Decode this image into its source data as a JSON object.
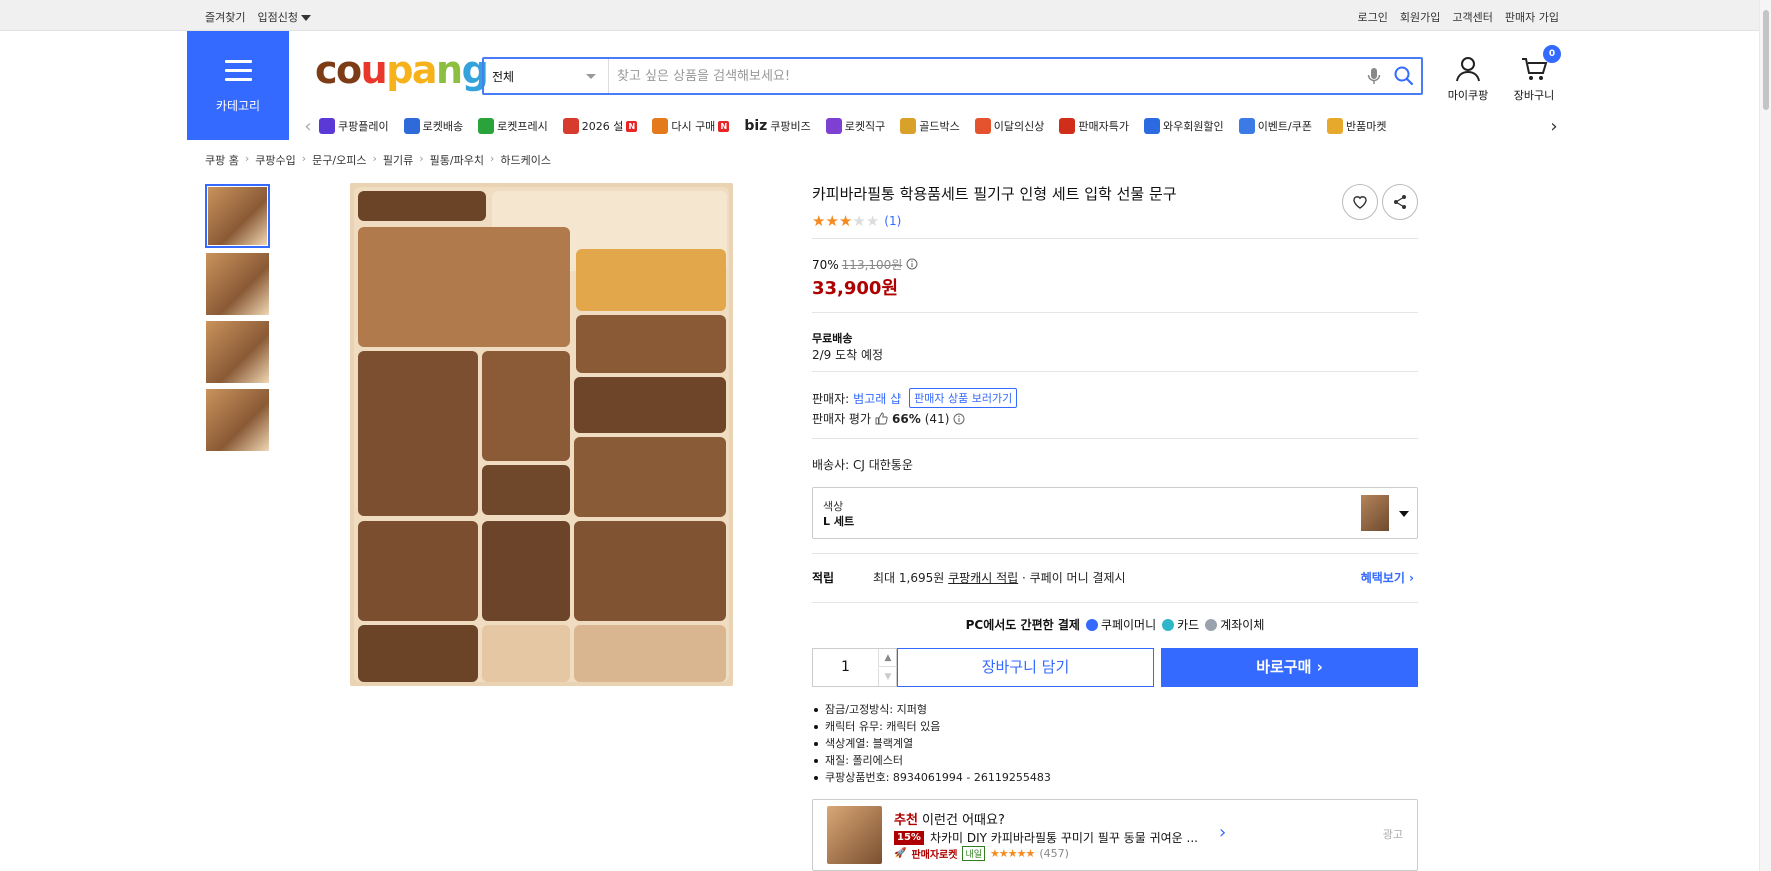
{
  "topbar": {
    "left": [
      {
        "label": "즐겨찾기"
      },
      {
        "label": "입점신청"
      }
    ],
    "right": [
      {
        "label": "로그인"
      },
      {
        "label": "회원가입"
      },
      {
        "label": "고객센터"
      },
      {
        "label": "판매자 가입"
      }
    ]
  },
  "header": {
    "category_label": "카테고리",
    "logo": {
      "c1": "co",
      "c2": "u",
      "c3": "pa",
      "c4": "n",
      "c5": "g"
    },
    "search": {
      "scope": "전체",
      "placeholder": "찾고 싶은 상품을 검색해보세요!"
    },
    "mycoupang_label": "마이쿠팡",
    "cart_label": "장바구니",
    "cart_count": "0"
  },
  "nav": {
    "items": [
      {
        "label": "쿠팡플레이",
        "icon": "play-icon",
        "color": "#5b39d6"
      },
      {
        "label": "로켓배송",
        "icon": "rocket-icon",
        "color": "#2f6ad9"
      },
      {
        "label": "로켓프레시",
        "icon": "rocket-fresh-icon",
        "color": "#29a33a"
      },
      {
        "label": "2026 설",
        "icon": "gift-icon",
        "color": "#d73b2d",
        "badge": "N"
      },
      {
        "label": "다시 구매",
        "icon": "house-icon",
        "color": "#e47a1b",
        "badge": "N"
      },
      {
        "label": "쿠팡비즈",
        "prefix": "biz",
        "icon": "",
        "color": ""
      },
      {
        "label": "로켓직구",
        "icon": "global-icon",
        "color": "#7e3fd3"
      },
      {
        "label": "골드박스",
        "icon": "goldbox-icon",
        "color": "#d8a12a"
      },
      {
        "label": "이달의신상",
        "icon": "bag-icon",
        "color": "#e5532e"
      },
      {
        "label": "판매자특가",
        "icon": "percent-icon",
        "color": "#d12d1b"
      },
      {
        "label": "와우회원할인",
        "icon": "wow-icon",
        "color": "#2b6ae0"
      },
      {
        "label": "이벤트/쿠폰",
        "icon": "coupon-icon",
        "color": "#3c7ae5"
      },
      {
        "label": "반품마켓",
        "icon": "market-icon",
        "color": "#e6a92b"
      }
    ]
  },
  "breadcrumb": [
    {
      "label": "쿠팡 홈"
    },
    {
      "label": "쿠팡수입"
    },
    {
      "label": "문구/오피스"
    },
    {
      "label": "필기류"
    },
    {
      "label": "필통/파우치"
    },
    {
      "label": "하드케이스"
    }
  ],
  "gallery": {
    "thumbnail_count": 4,
    "selected_index": 0
  },
  "product": {
    "title": "카피바라필통 학용품세트 필기구 인형 세트 입학 선물 문구",
    "rating": 3,
    "rating_max": 5,
    "review_count": "(1)",
    "discount_rate": "70%",
    "original_price": "113,100원",
    "sale_price": "33,900원",
    "shipping_type": "무료배송",
    "shipping_eta": "2/9 도착 예정",
    "seller_label": "판매자:",
    "seller_name": "범고래 샵",
    "seller_button": "판매자 상품 보러가기",
    "seller_rating_label": "판매자 평가",
    "seller_rating_pct": "66%",
    "seller_rating_count": "(41)",
    "carrier": "배송사:  CJ 대한통운",
    "option_label": "색상",
    "option_value": "L 세트",
    "points_title": "적립",
    "points_prefix": "최대 1,695원 ",
    "points_link": "쿠팡캐시 적립",
    "points_suffix": " · 쿠페이 머니 결제시",
    "points_more": "혜택보기 ›",
    "pay_title": "PC에서도 간편한 결제",
    "pay_methods": [
      {
        "label": "쿠페이머니",
        "color": "#346aff"
      },
      {
        "label": "카드",
        "color": "#2fb7c9"
      },
      {
        "label": "계좌이체",
        "color": "#9aa3ad"
      }
    ],
    "quantity": "1",
    "add_to_cart": "장바구니 담기",
    "buy_now": "바로구매 ›",
    "attributes": [
      "잠금/고정방식: 지퍼형",
      "캐릭터 유무: 캐릭터 있음",
      "색상계열: 블랙계열",
      "재질: 폴리에스터",
      "쿠팡상품번호: 8934061994 - 26119255483"
    ]
  },
  "recommend": {
    "head_red": "추천",
    "head_rest": " 이런건 어때요?",
    "discount": "15%",
    "title": "차카미 DIY 카피바라필통 꾸미기 필꾸 동물 귀여운 ...",
    "rocket_label": "판매자로켓",
    "tomorrow_label": "내일",
    "stars": "★★★★★",
    "review_count": "(457)",
    "ad_label": "광고"
  }
}
